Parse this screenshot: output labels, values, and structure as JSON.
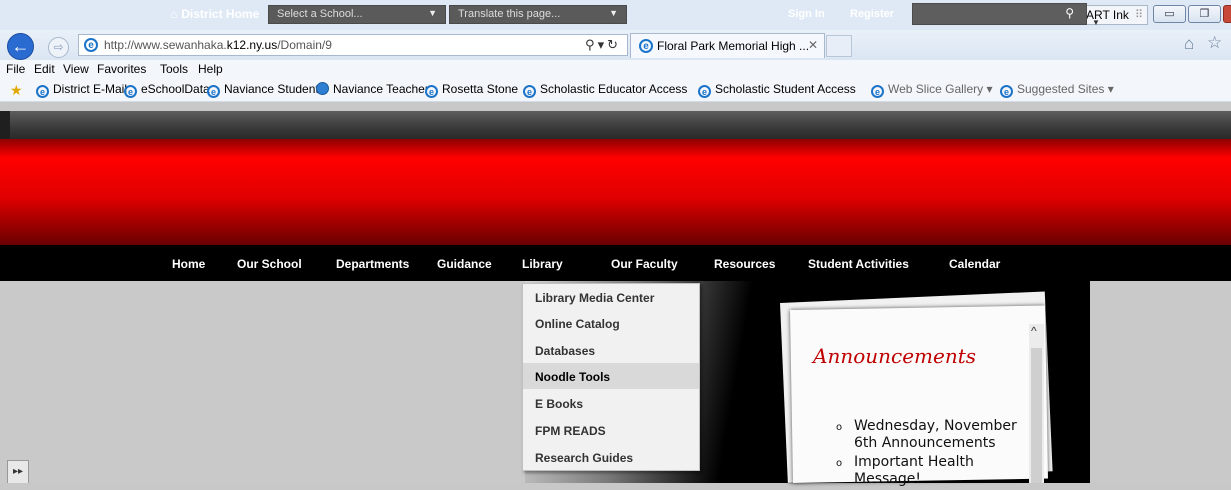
{
  "browser": {
    "url_prefix": "http://www.sewanhaka.",
    "url_domain": "k12.ny.us",
    "url_path": "/Domain/9",
    "tab_title": "Floral Park Memorial High ...",
    "smart_ink": "SMART Ink",
    "menu": [
      "File",
      "Edit",
      "View",
      "Favorites",
      "Tools",
      "Help"
    ],
    "favorites": [
      "District E-Mail",
      "eSchoolData",
      "Naviance Student",
      "Naviance Teacher",
      "Rosetta Stone",
      "Scholastic Educator Access",
      "Scholastic Student Access",
      "Web Slice Gallery ▾",
      "Suggested Sites ▾"
    ]
  },
  "site": {
    "top_bar": {
      "district_home": "District Home",
      "select_school": "Select a School...",
      "translate": "Translate this page...",
      "sign_in": "Sign In",
      "register": "Register"
    },
    "main_nav": [
      "Home",
      "Our School",
      "Departments",
      "Guidance",
      "Library",
      "Our Faculty",
      "Resources",
      "Student Activities",
      "Calendar"
    ],
    "library_menu": [
      "Library Media Center",
      "Online Catalog",
      "Databases",
      "Noodle Tools",
      "E Books",
      "FPM READS",
      "Research Guides"
    ],
    "library_menu_highlighted": "Noodle Tools",
    "announcements": {
      "title": "Announcements",
      "items": [
        "Wednesday, November 6th Announcements",
        "Important Health Message!"
      ]
    }
  },
  "colors": {
    "banner_red": "#ff0000",
    "announcement_title": "#c00000",
    "browser_back": "#2a6bd1"
  },
  "icons": [
    "back-icon",
    "forward-icon",
    "ie-icon",
    "search-icon",
    "refresh-icon",
    "home-icon",
    "star-icon",
    "house-icon",
    "magnifier-icon",
    "chevron-up-icon",
    "expand-icon"
  ]
}
